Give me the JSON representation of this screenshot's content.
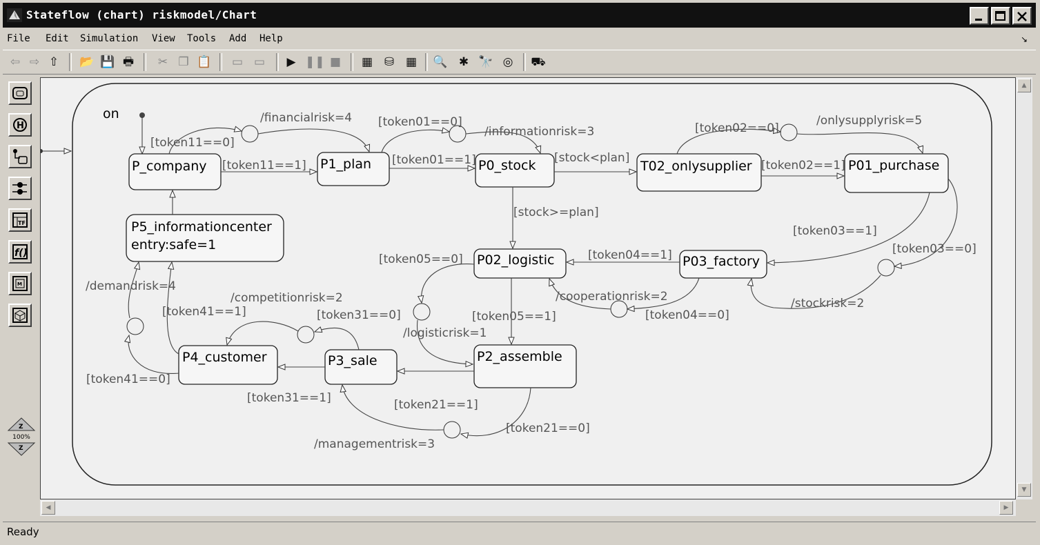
{
  "window": {
    "title": "Stateflow (chart) riskmodel/Chart"
  },
  "menubar": {
    "items": [
      "File",
      "Edit",
      "Simulation",
      "View",
      "Tools",
      "Add",
      "Help"
    ]
  },
  "toolbar": {
    "icons": [
      "back-icon",
      "forward-icon",
      "up-icon",
      "open-icon",
      "save-icon",
      "print-icon",
      "cut-icon",
      "copy-icon",
      "paste-icon",
      "undo-icon",
      "redo-icon",
      "play-icon",
      "pause-icon",
      "stop-icon",
      "build-icon",
      "rebuild-icon",
      "target-icon",
      "explore-icon",
      "debug-icon",
      "find-icon",
      "target-ring-icon",
      "model-icon"
    ]
  },
  "palette": {
    "tools": [
      "state-tool",
      "history-junction-tool",
      "default-transition-tool",
      "connective-junction-tool",
      "truth-table-tool",
      "function-tool",
      "embedded-matlab-tool",
      "box-tool"
    ],
    "zoom": "100%"
  },
  "chart": {
    "superstate": "on",
    "states": [
      {
        "id": "p_company",
        "name": "P_company"
      },
      {
        "id": "p1_plan",
        "name": "P1_plan"
      },
      {
        "id": "p0_stock",
        "name": "P0_stock"
      },
      {
        "id": "t02_onlysupplier",
        "name": "T02_onlysupplier"
      },
      {
        "id": "p01_purchase",
        "name": "P01_purchase"
      },
      {
        "id": "p5_infocenter",
        "name": "P5_informationcenter",
        "action": "entry:safe=1"
      },
      {
        "id": "p02_logistic",
        "name": "P02_logistic"
      },
      {
        "id": "p03_factory",
        "name": "P03_factory"
      },
      {
        "id": "p2_assemble",
        "name": "P2_assemble"
      },
      {
        "id": "p3_sale",
        "name": "P3_sale"
      },
      {
        "id": "p4_customer",
        "name": "P4_customer"
      }
    ],
    "labels": {
      "financialrisk": "/financialrisk=4",
      "token11_0": "[token11==0]",
      "token11_1": "[token11==1]",
      "token01_0": "[token01==0]",
      "informationrisk": "/informationrisk=3",
      "token01_1": "[token01==1]",
      "stock_lt_plan": "[stock<plan]",
      "token02_0": "[token02==0]",
      "onlysupplyrisk": "/onlysupplyrisk=5",
      "token02_1": "[token02==1]",
      "stock_ge_plan": "[stock>=plan]",
      "token03_1": "[token03==1]",
      "token03_0": "[token03==0]",
      "token05_0": "[token05==0]",
      "token04_1": "[token04==1]",
      "cooperationrisk": "/cooperationrisk=2",
      "stockrisk": "/stockrisk=2",
      "token04_0": "[token04==0]",
      "demandrisk": "/demandrisk=4",
      "competitionrisk": "/competitionrisk=2",
      "token41_1": "[token41==1]",
      "token31_0": "[token31==0]",
      "token05_1": "[token05==1]",
      "logisticrisk": "/logisticrisk=1",
      "token41_0": "[token41==0]",
      "token31_1": "[token31==1]",
      "token21_1": "[token21==1]",
      "token21_0": "[token21==0]",
      "managementrisk": "/managementrisk=3"
    }
  },
  "status": {
    "text": "Ready"
  }
}
